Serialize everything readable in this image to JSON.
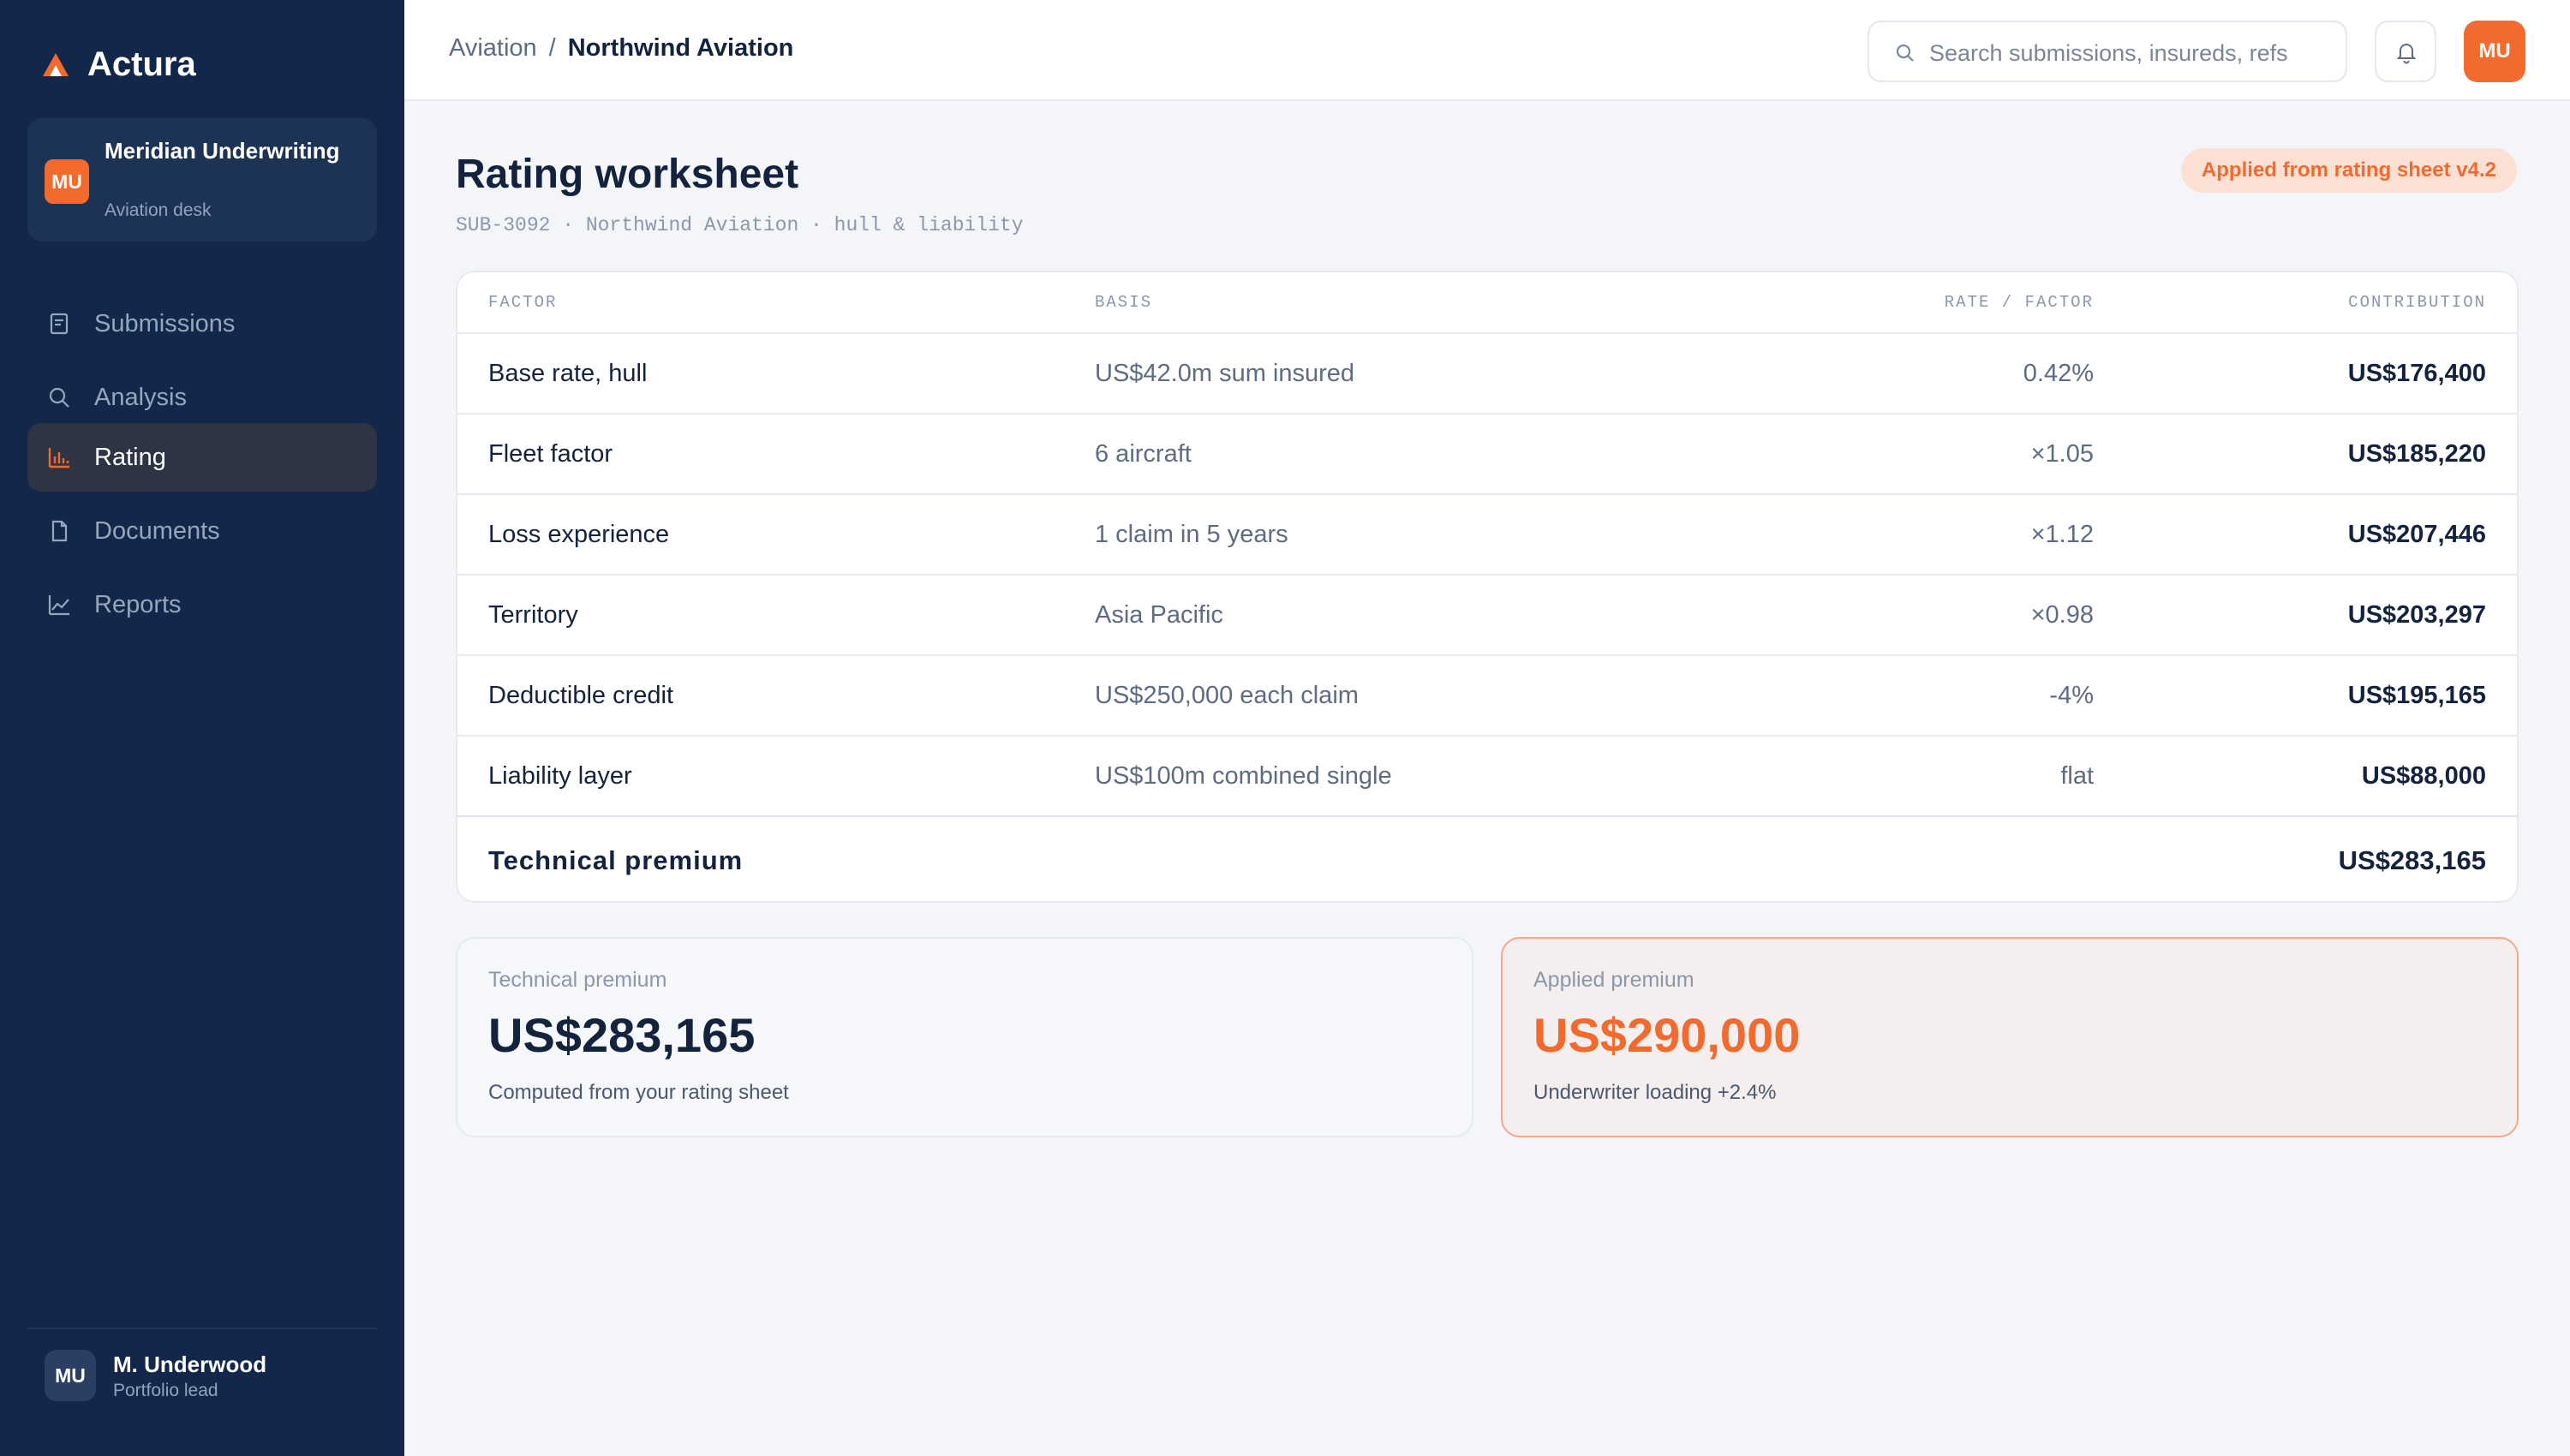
{
  "brand": {
    "name": "Actura"
  },
  "org": {
    "initials": "MU",
    "name": "Meridian Underwriting",
    "desk": "Aviation desk"
  },
  "nav": [
    {
      "label": "Submissions",
      "icon": "document-list-icon",
      "active": false
    },
    {
      "label": "Analysis",
      "icon": "search-icon",
      "active": false
    },
    {
      "label": "Rating",
      "icon": "bar-chart-icon",
      "active": true
    },
    {
      "label": "Documents",
      "icon": "file-icon",
      "active": false
    },
    {
      "label": "Reports",
      "icon": "line-chart-icon",
      "active": false
    }
  ],
  "user": {
    "initials": "MU",
    "name": "M. Underwood",
    "role": "Portfolio lead"
  },
  "breadcrumb": {
    "parent": "Aviation",
    "separator": "/",
    "current": "Northwind Aviation"
  },
  "search": {
    "placeholder": "Search submissions, insureds, refs"
  },
  "topbar": {
    "avatar_initials": "MU"
  },
  "page": {
    "title": "Rating worksheet",
    "subtitle": "SUB-3092 · Northwind Aviation · hull & liability",
    "pill": "Applied from rating sheet v4.2"
  },
  "table": {
    "headers": {
      "factor": "Factor",
      "basis": "Basis",
      "rate": "Rate / factor",
      "contribution": "Contribution"
    },
    "rows": [
      {
        "factor": "Base rate, hull",
        "basis": "US$42.0m sum insured",
        "rate": "0.42%",
        "contribution": "US$176,400"
      },
      {
        "factor": "Fleet factor",
        "basis": "6 aircraft",
        "rate": "×1.05",
        "contribution": "US$185,220"
      },
      {
        "factor": "Loss experience",
        "basis": "1 claim in 5 years",
        "rate": "×1.12",
        "contribution": "US$207,446"
      },
      {
        "factor": "Territory",
        "basis": "Asia Pacific",
        "rate": "×0.98",
        "contribution": "US$203,297"
      },
      {
        "factor": "Deductible credit",
        "basis": "US$250,000 each claim",
        "rate": "-4%",
        "contribution": "US$195,165"
      },
      {
        "factor": "Liability layer",
        "basis": "US$100m combined single",
        "rate": "flat",
        "contribution": "US$88,000"
      }
    ],
    "total": {
      "label": "Technical premium",
      "value": "US$283,165"
    }
  },
  "technical_premium": {
    "label": "Technical premium",
    "value": "US$283,165",
    "note": "Computed from your rating sheet"
  },
  "applied_premium": {
    "label": "Applied premium",
    "value": "US$290,000",
    "note": "Underwriter loading +2.4%"
  },
  "colors": {
    "accent": "#f26a2e",
    "sidebar": "#13274a",
    "text": "#13223d"
  }
}
